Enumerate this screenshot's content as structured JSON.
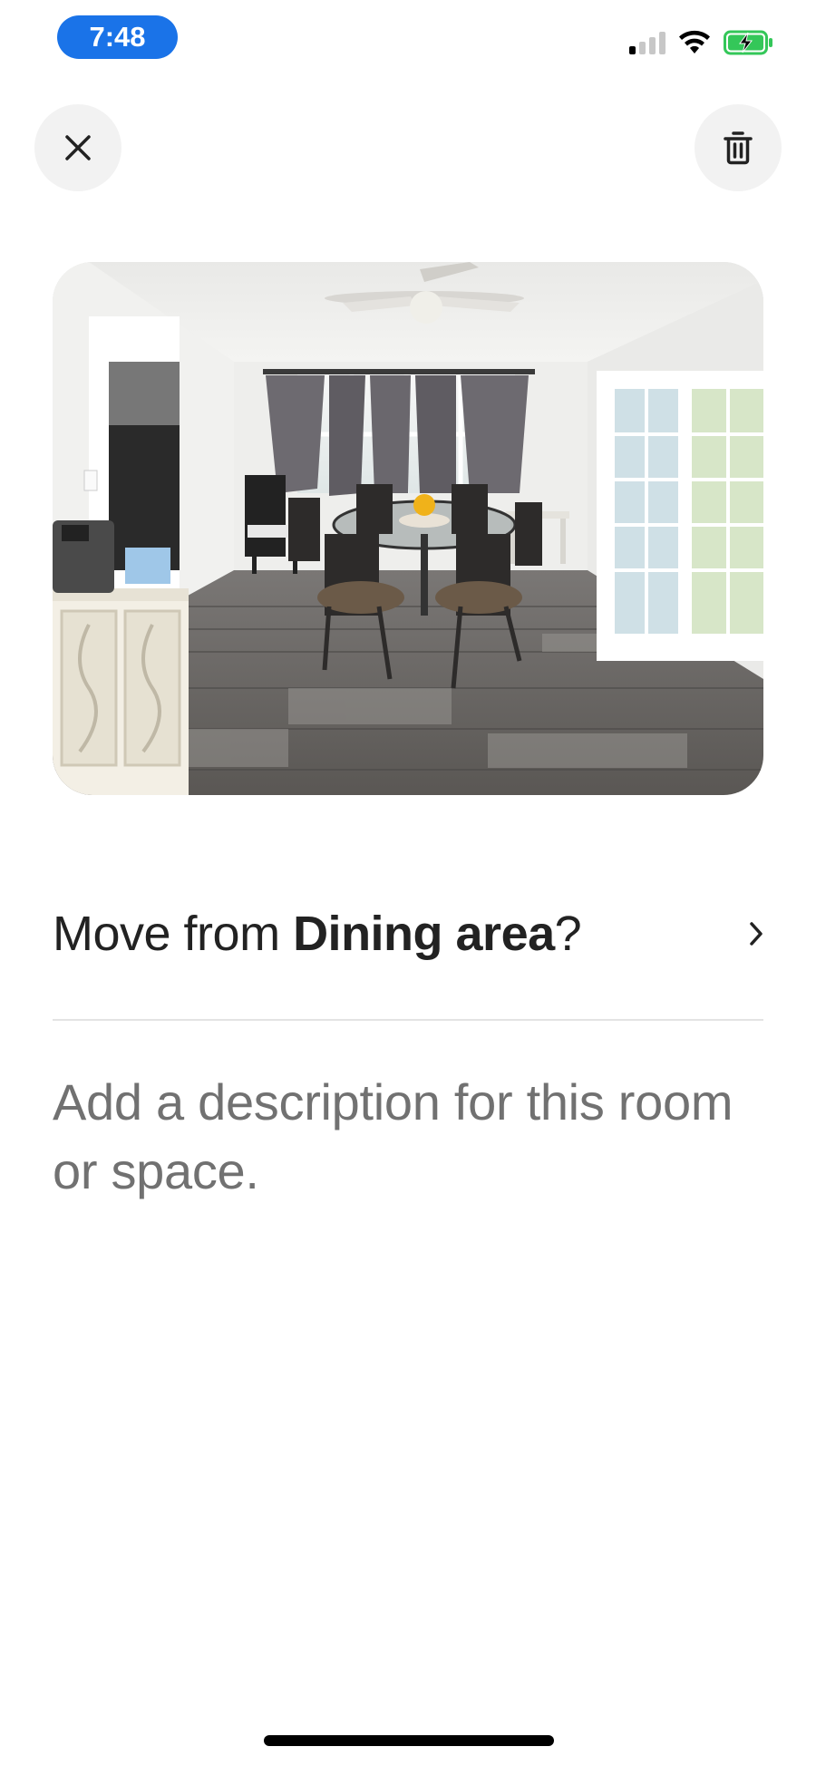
{
  "status_bar": {
    "time": "7:48",
    "icons": [
      "cellular-signal-icon",
      "wifi-icon",
      "battery-charging-icon"
    ],
    "accent": "#1a73e8",
    "battery_color": "#34c759"
  },
  "header": {
    "close_icon": "close-icon",
    "delete_icon": "trash-icon"
  },
  "photo": {
    "subject": "dining-room-photo"
  },
  "move": {
    "prefix": "Move from ",
    "room": "Dining area",
    "suffix": "?"
  },
  "description": {
    "placeholder": "Add a description for this room or space."
  }
}
